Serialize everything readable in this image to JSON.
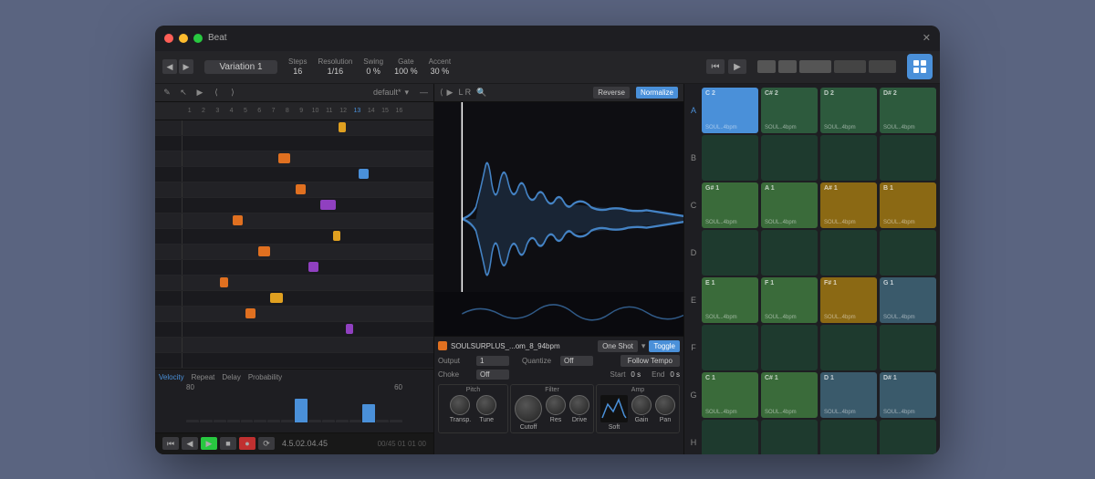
{
  "window": {
    "title": "Beat",
    "close": "✕",
    "minimize": "–",
    "maximize": "+"
  },
  "toolbar": {
    "variation": "Variation 1",
    "steps_label": "Steps",
    "steps_value": "16",
    "resolution_label": "Resolution",
    "resolution_value": "1/16",
    "swing_label": "Swing",
    "swing_value": "0 %",
    "gate_label": "Gate",
    "gate_value": "100 %",
    "accent_label": "Accent",
    "accent_value": "30 %",
    "default_preset": "default*"
  },
  "sample": {
    "filename": "SOULSURPLUS_...om_8_94bpm",
    "one_shot": "One Shot",
    "toggle": "Toggle",
    "output_label": "Output",
    "output_value": "1",
    "quantize_label": "Quantize",
    "quantize_value": "Off",
    "follow_tempo": "Follow Tempo",
    "choke_label": "Choke",
    "choke_value": "Off",
    "start_label": "Start",
    "start_value": "0 s",
    "end_label": "End",
    "end_value": "0 s",
    "reverse_btn": "Reverse",
    "normalize_btn": "Normalize",
    "sections": {
      "pitch": "Pitch",
      "filter": "Filter",
      "amp": "Amp"
    },
    "knobs": {
      "transp": "Transp.",
      "tune": "Tune",
      "cutoff": "Cutoff",
      "res": "Res",
      "drive": "Drive",
      "gain": "Gain",
      "pan": "Pan",
      "soft": "Soft"
    }
  },
  "pads": {
    "rows": [
      {
        "letter": "A",
        "active": true,
        "pads": [
          {
            "note": "C 2",
            "sample": "SOUL..4bpm",
            "color": "#4a90d9",
            "active": true
          },
          {
            "note": "C# 2",
            "sample": "SOUL..4bpm",
            "color": "#2d5a3d"
          },
          {
            "note": "D 2",
            "sample": "SOUL..4bpm",
            "color": "#2d5a3d"
          },
          {
            "note": "D# 2",
            "sample": "SOUL..4bpm",
            "color": "#2d5a3d"
          }
        ]
      },
      {
        "letter": "B",
        "pads": [
          {
            "note": "",
            "sample": "",
            "color": "#1e3a2e"
          },
          {
            "note": "",
            "sample": "",
            "color": "#1e3a2e"
          },
          {
            "note": "",
            "sample": "",
            "color": "#1e3a2e"
          },
          {
            "note": "",
            "sample": "",
            "color": "#1e3a2e"
          }
        ]
      },
      {
        "letter": "C",
        "pads": [
          {
            "note": "G# 1",
            "sample": "SOUL..4bpm",
            "color": "#3a6b3a"
          },
          {
            "note": "A 1",
            "sample": "SOUL..4bpm",
            "color": "#3a6b3a"
          },
          {
            "note": "A# 1",
            "sample": "SOUL..4bpm",
            "color": "#8b6914"
          },
          {
            "note": "B 1",
            "sample": "SOUL..4bpm",
            "color": "#8b6914"
          }
        ]
      },
      {
        "letter": "D",
        "pads": [
          {
            "note": "",
            "sample": "",
            "color": "#1e3a2e"
          },
          {
            "note": "",
            "sample": "",
            "color": "#1e3a2e"
          },
          {
            "note": "",
            "sample": "",
            "color": "#1e3a2e"
          },
          {
            "note": "",
            "sample": "",
            "color": "#1e3a2e"
          }
        ]
      },
      {
        "letter": "E",
        "pads": [
          {
            "note": "E 1",
            "sample": "SOUL..4bpm",
            "color": "#3a6b3a"
          },
          {
            "note": "F 1",
            "sample": "SOUL..4bpm",
            "color": "#3a6b3a"
          },
          {
            "note": "F# 1",
            "sample": "SOUL..4bpm",
            "color": "#8b6914"
          },
          {
            "note": "G 1",
            "sample": "SOUL..4bpm",
            "color": "#3a5a6b"
          }
        ]
      },
      {
        "letter": "F",
        "pads": [
          {
            "note": "",
            "sample": "",
            "color": "#1e3a2e"
          },
          {
            "note": "",
            "sample": "",
            "color": "#1e3a2e"
          },
          {
            "note": "",
            "sample": "",
            "color": "#1e3a2e"
          },
          {
            "note": "",
            "sample": "",
            "color": "#1e3a2e"
          }
        ]
      },
      {
        "letter": "G",
        "pads": [
          {
            "note": "C 1",
            "sample": "SOUL..4bpm",
            "color": "#3a6b3a"
          },
          {
            "note": "C# 1",
            "sample": "SOUL..4bpm",
            "color": "#3a6b3a"
          },
          {
            "note": "D 1",
            "sample": "SOUL..4bpm",
            "color": "#3a5a6b"
          },
          {
            "note": "D# 1",
            "sample": "SOUL..4bpm",
            "color": "#3a5a6b"
          }
        ]
      },
      {
        "letter": "H",
        "pads": [
          {
            "note": "",
            "sample": "",
            "color": "#1e3a2e"
          },
          {
            "note": "",
            "sample": "",
            "color": "#1e3a2e"
          },
          {
            "note": "",
            "sample": "",
            "color": "#1e3a2e"
          },
          {
            "note": "",
            "sample": "",
            "color": "#1e3a2e"
          }
        ]
      }
    ]
  },
  "velocity": {
    "buttons": [
      "Velocity",
      "Repeat",
      "Delay",
      "Probability"
    ],
    "active_btn": "Velocity",
    "bars": [
      0,
      0,
      0,
      0,
      0,
      0,
      0,
      0,
      80,
      0,
      0,
      0,
      0,
      60,
      0,
      0
    ]
  },
  "timeline": {
    "position": "4.5.02.04.45",
    "end_position": "00/45  01  01  00"
  },
  "piano_roll": {
    "notes": [
      {
        "row": 0,
        "left_pct": 62,
        "width_pct": 3,
        "color": "#e0a020"
      },
      {
        "row": 2,
        "left_pct": 38,
        "width_pct": 5,
        "color": "#e07020"
      },
      {
        "row": 4,
        "left_pct": 45,
        "width_pct": 4,
        "color": "#e07020"
      },
      {
        "row": 5,
        "left_pct": 55,
        "width_pct": 6,
        "color": "#9040c0"
      },
      {
        "row": 6,
        "left_pct": 20,
        "width_pct": 4,
        "color": "#e07020"
      },
      {
        "row": 7,
        "left_pct": 60,
        "width_pct": 3,
        "color": "#e0a020"
      },
      {
        "row": 8,
        "left_pct": 30,
        "width_pct": 5,
        "color": "#e07020"
      },
      {
        "row": 9,
        "left_pct": 50,
        "width_pct": 4,
        "color": "#9040c0"
      },
      {
        "row": 10,
        "left_pct": 15,
        "width_pct": 3,
        "color": "#e07020"
      },
      {
        "row": 11,
        "left_pct": 35,
        "width_pct": 5,
        "color": "#e0a020"
      },
      {
        "row": 12,
        "left_pct": 25,
        "width_pct": 4,
        "color": "#e07020"
      },
      {
        "row": 13,
        "left_pct": 65,
        "width_pct": 3,
        "color": "#9040c0"
      },
      {
        "row": 3,
        "left_pct": 70,
        "width_pct": 4,
        "color": "#4a90d9"
      }
    ]
  }
}
